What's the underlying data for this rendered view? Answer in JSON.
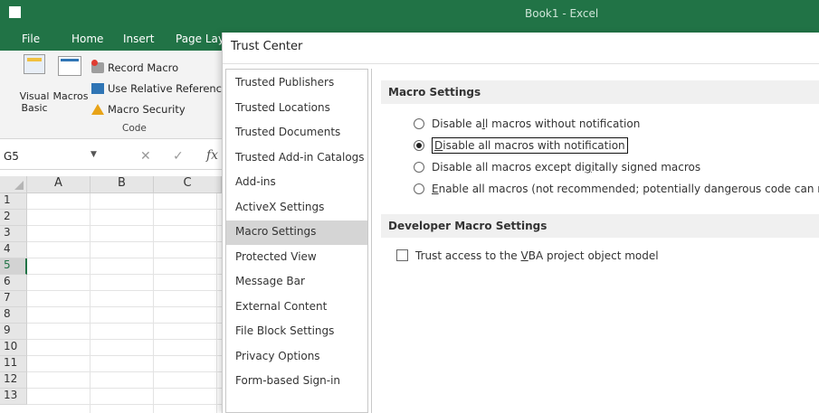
{
  "titlebar": {
    "document_title": "Book1  -  Excel"
  },
  "ribbon_tabs": [
    {
      "label": "File"
    },
    {
      "label": "Home"
    },
    {
      "label": "Insert"
    },
    {
      "label": "Page Lay"
    }
  ],
  "ribbon": {
    "visual_basic_line1": "Visual",
    "visual_basic_line2": "Basic",
    "macros_label": "Macros",
    "record_macro": "Record Macro",
    "use_relative": "Use Relative References",
    "macro_security": "Macro Security",
    "group_label": "Code"
  },
  "formula_bar": {
    "name_box": "G5",
    "cancel_glyph": "✕",
    "enter_glyph": "✓",
    "fx_glyph": "fx"
  },
  "grid": {
    "columns": [
      "A",
      "B",
      "C"
    ],
    "rows": [
      "1",
      "2",
      "3",
      "4",
      "5",
      "6",
      "7",
      "8",
      "9",
      "10",
      "11",
      "12",
      "13"
    ],
    "active_row": "5"
  },
  "dialog": {
    "title": "Trust Center",
    "nav_items": [
      {
        "label": "Trusted Publishers",
        "selected": false
      },
      {
        "label": "Trusted Locations",
        "selected": false
      },
      {
        "label": "Trusted Documents",
        "selected": false
      },
      {
        "label": "Trusted Add-in Catalogs",
        "selected": false
      },
      {
        "label": "Add-ins",
        "selected": false
      },
      {
        "label": "ActiveX Settings",
        "selected": false
      },
      {
        "label": "Macro Settings",
        "selected": true
      },
      {
        "label": "Protected View",
        "selected": false
      },
      {
        "label": "Message Bar",
        "selected": false
      },
      {
        "label": "External Content",
        "selected": false
      },
      {
        "label": "File Block Settings",
        "selected": false
      },
      {
        "label": "Privacy Options",
        "selected": false
      },
      {
        "label": "Form-based Sign-in",
        "selected": false
      }
    ],
    "macro_settings": {
      "header": "Macro Settings",
      "options": [
        {
          "pre": "Disable a",
          "ul": "l",
          "post": "l macros without notification",
          "checked": false
        },
        {
          "pre": "",
          "ul": "D",
          "post": "isable all macros with notification",
          "checked": true
        },
        {
          "pre": "Disable all macros except di",
          "ul": "g",
          "post": "itally signed macros",
          "checked": false
        },
        {
          "pre": "",
          "ul": "E",
          "post": "nable all macros (not recommended; potentially dangerous code can run)",
          "checked": false
        }
      ]
    },
    "developer_settings": {
      "header": "Developer Macro Settings",
      "trust_vba_pre": "Trust access to the ",
      "trust_vba_ul": "V",
      "trust_vba_post": "BA project object model",
      "trust_vba_checked": false
    }
  }
}
